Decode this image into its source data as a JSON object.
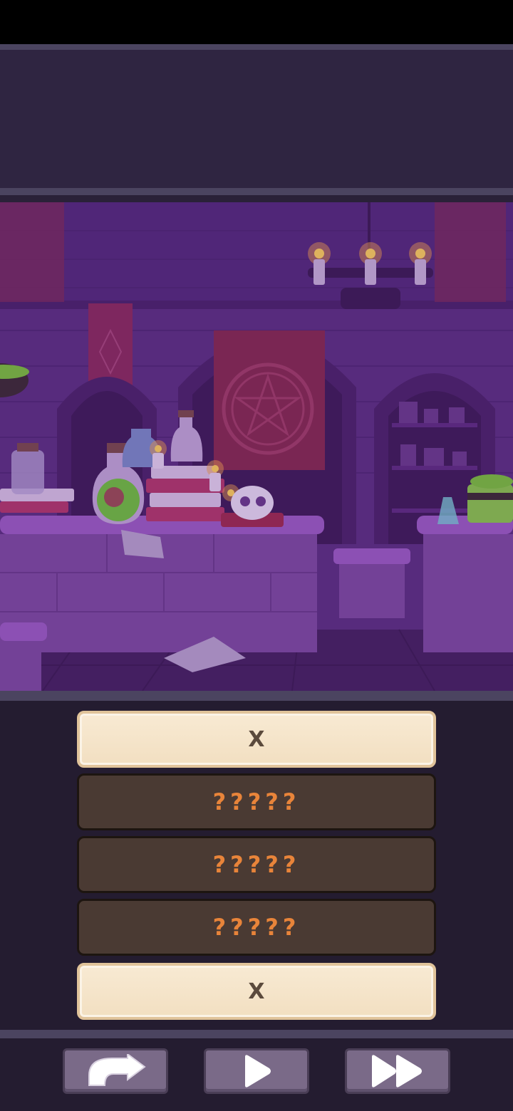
{
  "answers": [
    {
      "text": "X",
      "state": "revealed"
    },
    {
      "text": "?????",
      "state": "hidden"
    },
    {
      "text": "?????",
      "state": "hidden"
    },
    {
      "text": "?????",
      "state": "hidden"
    },
    {
      "text": "X",
      "state": "revealed"
    }
  ],
  "controls": {
    "undo_icon": "curved-arrow-icon",
    "play_icon": "play-icon",
    "fast_forward_icon": "fast-forward-icon"
  },
  "colors": {
    "revealed_bg": "#f8ead3",
    "hidden_bg": "#4a3a33",
    "hidden_text": "#e8843a",
    "scene_purple": "#5a2f7e"
  }
}
